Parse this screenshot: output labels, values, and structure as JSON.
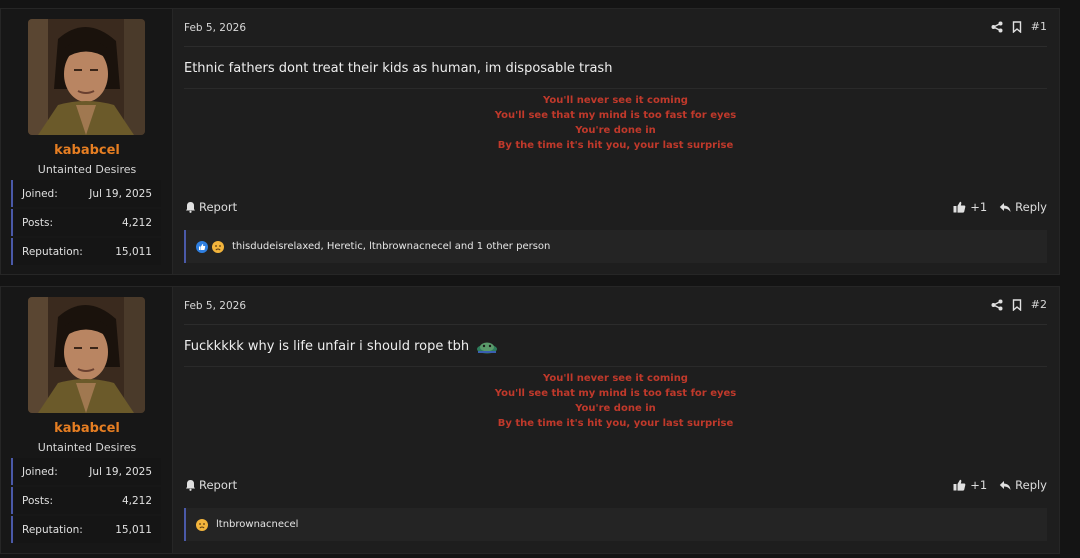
{
  "posts": [
    {
      "user": {
        "name": "kababcel",
        "title": "Untainted Desires"
      },
      "stats": [
        {
          "label": "Joined:",
          "value": "Jul 19, 2025"
        },
        {
          "label": "Posts:",
          "value": "4,212"
        },
        {
          "label": "Reputation:",
          "value": "15,011"
        }
      ],
      "date": "Feb 5, 2026",
      "number": "#1",
      "message": "Ethnic fathers dont treat their kids as human, im disposable trash",
      "signature": [
        "You'll never see it coming",
        "You'll see that my mind is too fast for eyes",
        "You're done in",
        "By the time it's hit you, your last surprise"
      ],
      "report_label": "Report",
      "like_count": "+1",
      "reply_label": "Reply",
      "reactions_text": "thisdudeisrelaxed, Heretic, ltnbrownacnecel and 1 other person"
    },
    {
      "user": {
        "name": "kababcel",
        "title": "Untainted Desires"
      },
      "stats": [
        {
          "label": "Joined:",
          "value": "Jul 19, 2025"
        },
        {
          "label": "Posts:",
          "value": "4,212"
        },
        {
          "label": "Reputation:",
          "value": "15,011"
        }
      ],
      "date": "Feb 5, 2026",
      "number": "#2",
      "message": "Fuckkkkk why is life unfair i should rope tbh",
      "signature": [
        "You'll never see it coming",
        "You'll see that my mind is too fast for eyes",
        "You're done in",
        "By the time it's hit you, your last surprise"
      ],
      "report_label": "Report",
      "like_count": "+1",
      "reply_label": "Reply",
      "reactions_text": "ltnbrownacnecel"
    }
  ],
  "colors": {
    "username": "#e67e22",
    "signature": "#c0392b",
    "accent_border": "#4a59a8",
    "like_reaction": "#2f7fe0",
    "sad_reaction": "#f2b43c"
  }
}
